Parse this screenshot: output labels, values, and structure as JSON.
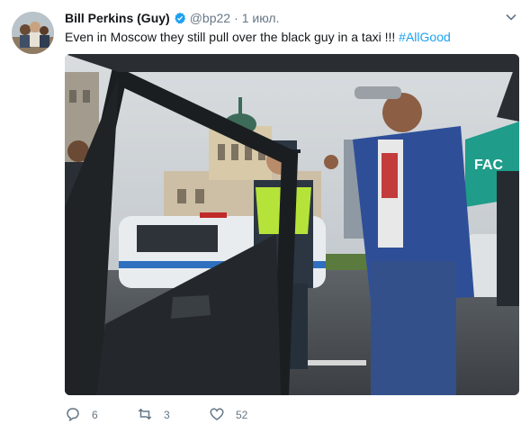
{
  "tweet": {
    "author_name": "Bill Perkins (Guy)",
    "handle": "@bp22",
    "separator": "·",
    "date": "1 июл.",
    "text_main": "Even in Moscow they still pull over the black guy in a taxi !!! ",
    "hashtag": "#AllGood"
  },
  "actions": {
    "reply_count": "6",
    "retweet_count": "3",
    "like_count": "52"
  },
  "icons": {
    "verified": "verified-badge-icon",
    "caret": "chevron-down-icon",
    "reply": "reply-icon",
    "retweet": "retweet-icon",
    "like": "heart-icon"
  },
  "colors": {
    "link": "#1da1f2",
    "secondary_text": "#657786",
    "verified": "#1da1f2"
  }
}
